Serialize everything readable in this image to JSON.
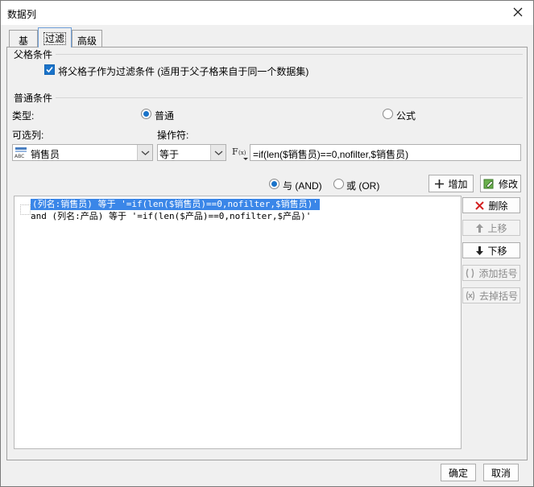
{
  "window": {
    "title": "数据列"
  },
  "tabs": [
    {
      "label": "基本",
      "active": false
    },
    {
      "label": "过滤",
      "active": true
    },
    {
      "label": "高级",
      "active": false
    }
  ],
  "parent_section": {
    "title": "父格条件",
    "checkbox_label": "将父格子作为过滤条件 (适用于父子格来自于同一个数据集)",
    "checked": true
  },
  "normal_section": {
    "title": "普通条件",
    "type_label": "类型:",
    "type_options": [
      {
        "label": "普通",
        "selected": true
      },
      {
        "label": "公式",
        "selected": false
      }
    ],
    "column_label": "可选列:",
    "operator_label": "操作符:",
    "column_value": "销售员",
    "operator_value": "等于",
    "formula_value": "=if(len($销售员)==0,nofilter,$销售员)"
  },
  "logic": {
    "and_label": "与 (AND)",
    "or_label": "或 (OR)",
    "and_selected": true,
    "add_button": "增加",
    "modify_button": "修改"
  },
  "conditions": [
    {
      "text": "(列名:销售员) 等于 '=if(len($销售员)==0,nofilter,$销售员)'",
      "selected": true
    },
    {
      "text": "and (列名:产品) 等于 '=if(len($产品)==0,nofilter,$产品)'",
      "selected": false
    }
  ],
  "side_buttons": {
    "delete": "删除",
    "up": "上移",
    "down": "下移",
    "add_bracket": "添加括号",
    "remove_bracket": "去掉括号"
  },
  "footer": {
    "ok": "确定",
    "cancel": "取消"
  },
  "colors": {
    "accent": "#1a73c9",
    "selection": "#3a86e8"
  }
}
